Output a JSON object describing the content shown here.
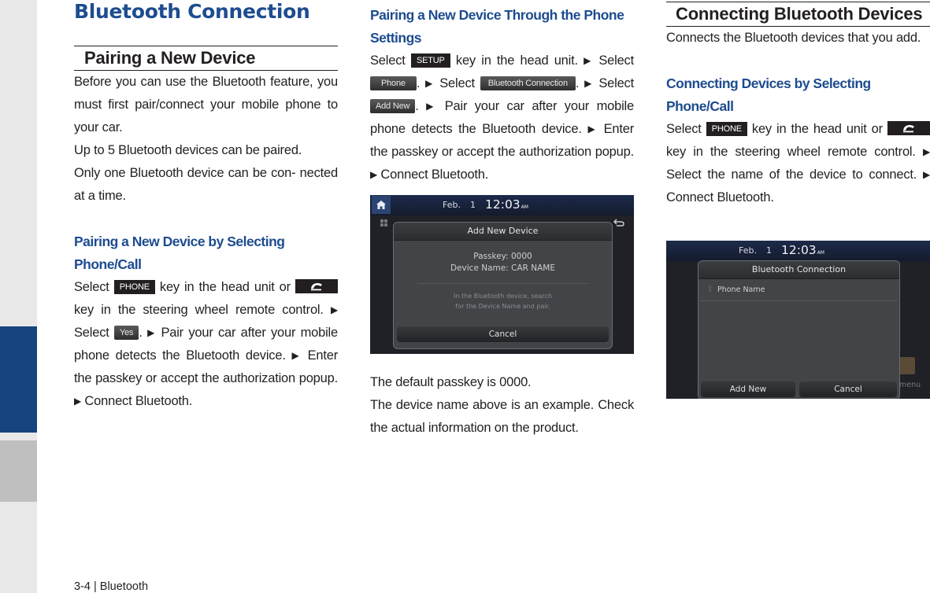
{
  "sidebar": {
    "accent_color": "#17437f"
  },
  "chapter_title": "Bluetooth Connection",
  "col1": {
    "section_title": "Pairing a New Device",
    "intro": "Before you can use the Bluetooth feature, you must first pair/connect your mobile phone to your car.",
    "note1": "Up to 5 Bluetooth devices can be paired.",
    "note2": "Only one Bluetooth device can be con- nected at a time.",
    "subsection_title": "Pairing a New Device by Selecting Phone/Call",
    "steps": {
      "t1": "Select",
      "key_phone": "PHONE",
      "t2": "key in the head unit or",
      "t3": "key in the steering wheel remote control.",
      "t4": "Select",
      "key_yes": "Yes",
      "t5": ".",
      "t6": "Pair your car after your mobile phone detects the Bluetooth device.",
      "t7": "Enter the passkey or accept the authorization popup.",
      "t8": "Connect Bluetooth."
    }
  },
  "col2": {
    "subsection_title": "Pairing a New Device Through the Phone Settings",
    "steps": {
      "t1": "Select",
      "key_setup": "SETUP",
      "t2": "key in the head unit.",
      "t3": "Select",
      "key_phone": "Phone",
      "t4": ".",
      "t5": "Select",
      "key_bt": "Bluetooth Connection",
      "t6": ".",
      "t7": "Select",
      "key_add": "Add New",
      "t8": ".",
      "t9": "Pair your car after your mobile phone detects the Bluetooth device.",
      "t10": "Enter the passkey or accept the authorization popup.",
      "t11": "Connect Bluetooth."
    },
    "screen": {
      "date": "Feb.",
      "day": "1",
      "time": "12:03",
      "ampm": "AM",
      "popup_title": "Add New Device",
      "passkey_label": "Passkey:",
      "passkey_value": "0000",
      "device_label": "Device Name:",
      "device_value": "CAR NAME",
      "hint": "In the Bluetooth device, search for the Device Name and pair.",
      "cancel": "Cancel"
    },
    "note1": "The default passkey is 0000.",
    "note2": "The device name above is an example. Check the actual information on the product."
  },
  "col3": {
    "section_title": "Connecting Bluetooth Devices",
    "intro": "Connects the Bluetooth devices that you add.",
    "subsection_title": "Connecting Devices by Selecting Phone/Call",
    "steps": {
      "t1": "Select",
      "key_phone": "PHONE",
      "t2": "key in the head unit or",
      "t3": "key in the steering wheel remote control.",
      "t4": "Select the name of the device to connect.",
      "t5": "Connect Bluetooth."
    },
    "screen": {
      "date": "Feb.",
      "day": "1",
      "time": "12:03",
      "ampm": "AM",
      "popup_title": "Bluetooth Connection",
      "device_item": "Phone Name",
      "add_new": "Add New",
      "cancel": "Cancel",
      "bg_label": "menu"
    }
  },
  "footer": {
    "page": "3-4 | Bluetooth"
  },
  "arrow_glyph": "▶"
}
